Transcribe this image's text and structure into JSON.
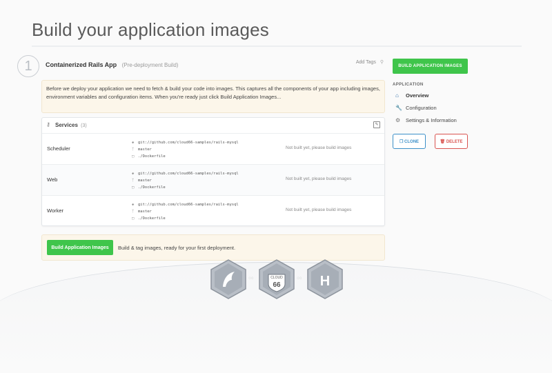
{
  "page": {
    "title": "Build your application images"
  },
  "step": {
    "number": "1"
  },
  "app": {
    "name": "Containerized Rails App",
    "subtitle": "(Pre-deployment Build)",
    "add_tags": "Add Tags"
  },
  "notice": {
    "text": "Before we deploy your application we need to fetch & build your code into images. This captures all the components of your app including images, environment variables and configuration items. When you're ready just click Build Application Images..."
  },
  "services": {
    "label": "Services",
    "count": "(3)",
    "rows": [
      {
        "name": "Scheduler",
        "repo": "git://github.com/cloud66-samples/rails-mysql",
        "branch": "master",
        "file": "./Dockerfile",
        "status": "Not built yet, please build images"
      },
      {
        "name": "Web",
        "repo": "git://github.com/cloud66-samples/rails-mysql",
        "branch": "master",
        "file": "./Dockerfile",
        "status": "Not built yet, please build images"
      },
      {
        "name": "Worker",
        "repo": "git://github.com/cloud66-samples/rails-mysql",
        "branch": "master",
        "file": "./Dockerfile",
        "status": "Not built yet, please build images"
      }
    ]
  },
  "build_bar": {
    "button": "Build Application Images",
    "text": "Build & tag images, ready for your first deployment."
  },
  "sidebar": {
    "build_button": "BUILD APPLICATION IMAGES",
    "section": "APPLICATION",
    "items": [
      {
        "label": "Overview",
        "icon": "home-icon"
      },
      {
        "label": "Configuration",
        "icon": "wrench-icon"
      },
      {
        "label": "Settings & Information",
        "icon": "gear-icon"
      }
    ],
    "clone": "CLONE",
    "delete": "DELETE"
  },
  "footer": {
    "cloud_badge_text": "CLOUD",
    "cloud_badge_number": "66",
    "h_badge_text": "H"
  },
  "colors": {
    "green": "#3fc54b",
    "blue": "#3b8fc8",
    "red": "#d9534f",
    "notice_bg": "#fcf6ea"
  }
}
